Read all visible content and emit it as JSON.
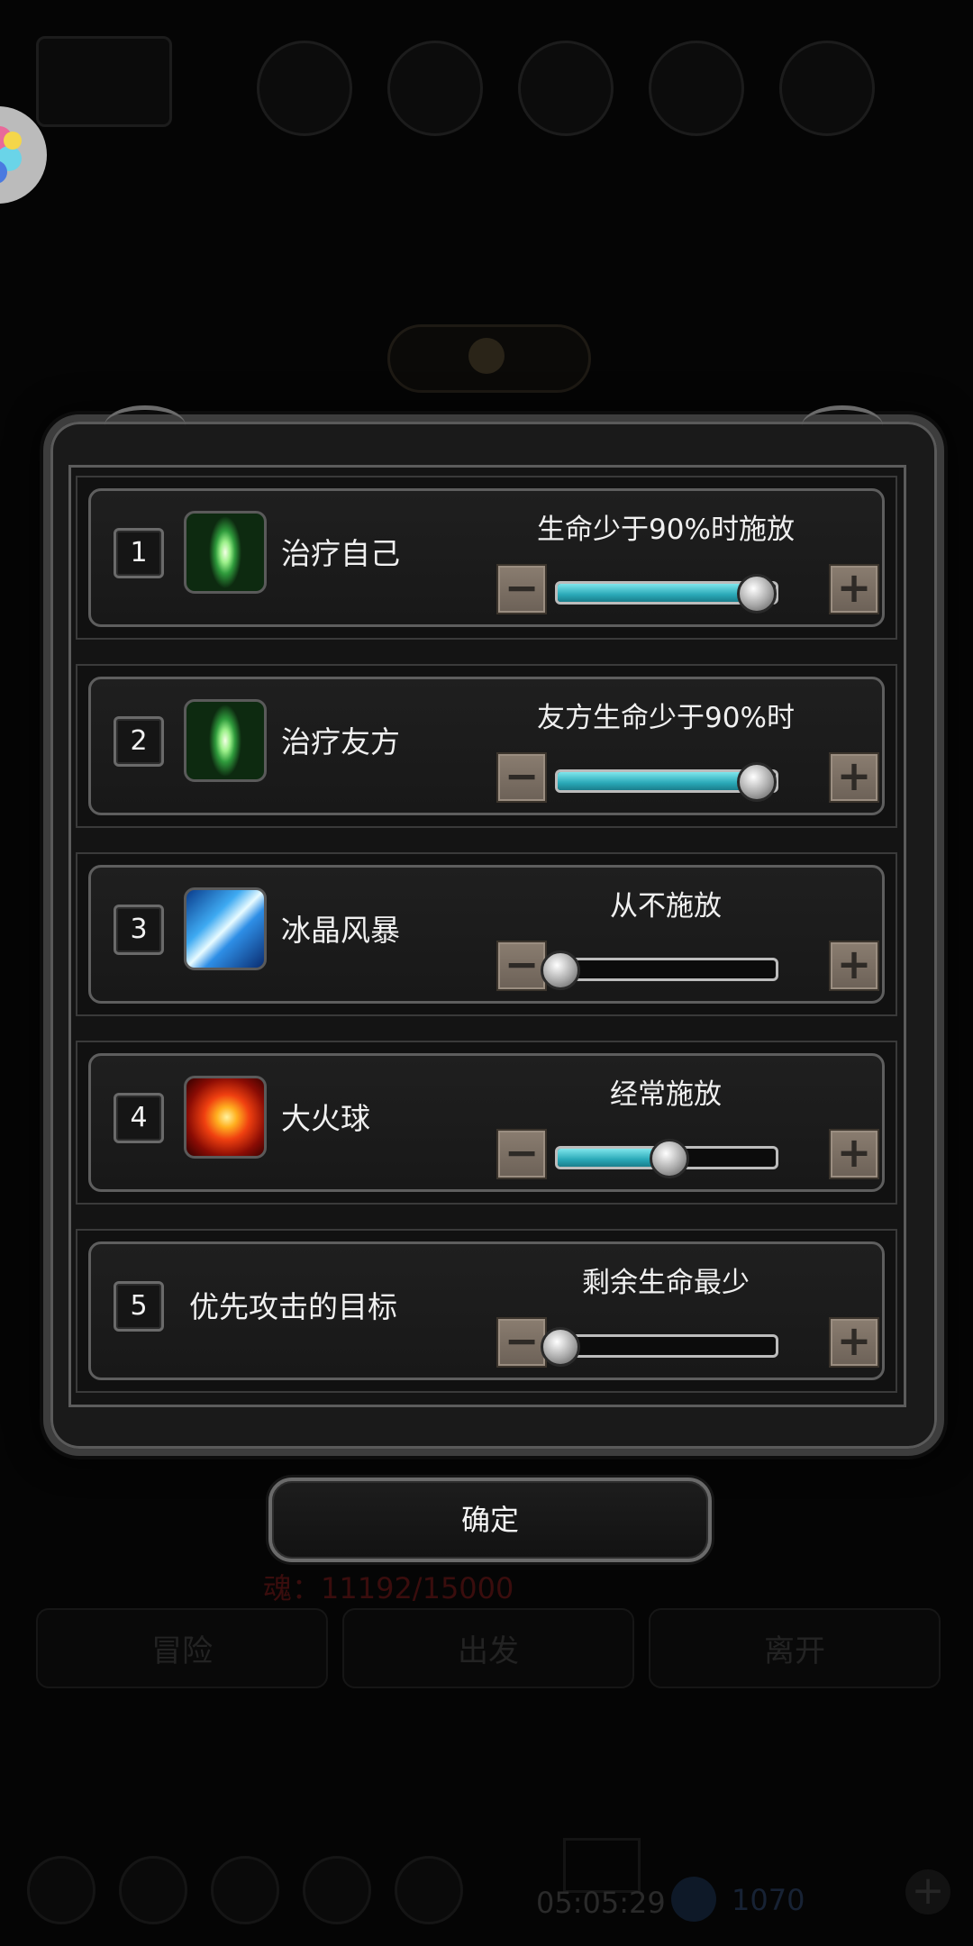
{
  "rows": [
    {
      "num": "1",
      "icon": "heal-self-icon",
      "name": "治疗自己",
      "setting": "生命少于90%时施放",
      "level": 0.9
    },
    {
      "num": "2",
      "icon": "heal-ally-icon",
      "name": "治疗友方",
      "setting": "友方生命少于90%时",
      "level": 0.9
    },
    {
      "num": "3",
      "icon": "ice-storm-icon",
      "name": "冰晶风暴",
      "setting": "从不施放",
      "level": 0.0
    },
    {
      "num": "4",
      "icon": "fireball-icon",
      "name": "大火球",
      "setting": "经常施放",
      "level": 0.5
    },
    {
      "num": "5",
      "icon": "",
      "name": "优先攻击的目标",
      "setting": "剩余生命最少",
      "level": 0.0
    }
  ],
  "confirm_label": "确定",
  "background": {
    "soul": "魂：11192/15000",
    "tabs": [
      "冒险",
      "出发",
      "离开"
    ],
    "time": "05:05:29",
    "gems": "1070"
  },
  "colors": {
    "slider_fill": "#2aa9b8",
    "stepper": "#7a6e62"
  }
}
